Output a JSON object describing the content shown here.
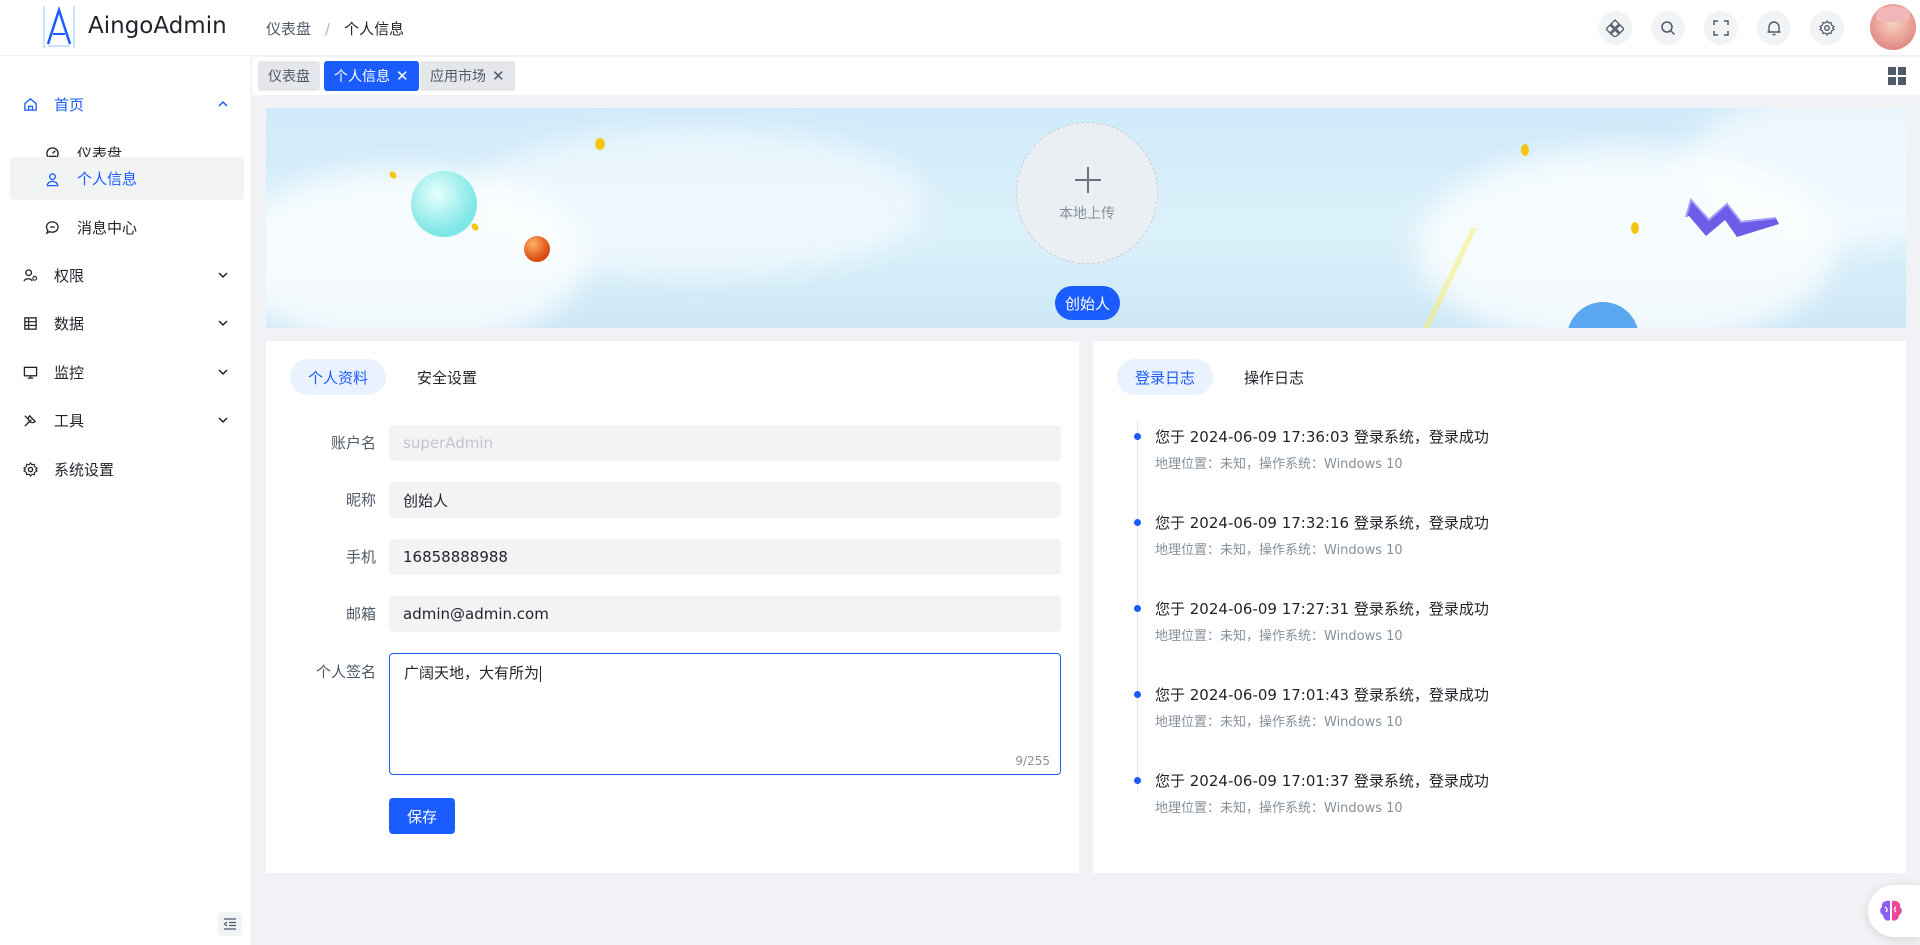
{
  "app": {
    "name": "AingoAdmin"
  },
  "breadcrumb": [
    "仪表盘",
    "个人信息"
  ],
  "header": {
    "icons": [
      "app-grid-icon",
      "search-icon",
      "fullscreen-icon",
      "bell-icon",
      "gear-icon"
    ]
  },
  "sidebar": {
    "items": [
      {
        "label": "首页",
        "icon": "home-icon",
        "expanded": true
      },
      {
        "label": "仪表盘",
        "icon": "dashboard-icon",
        "sub": true
      },
      {
        "label": "个人信息",
        "icon": "user-icon",
        "sub": true,
        "active": true
      },
      {
        "label": "消息中心",
        "icon": "message-icon",
        "sub": true
      },
      {
        "label": "权限",
        "icon": "permission-icon"
      },
      {
        "label": "数据",
        "icon": "data-icon"
      },
      {
        "label": "监控",
        "icon": "monitor-icon"
      },
      {
        "label": "工具",
        "icon": "tool-icon"
      },
      {
        "label": "系统设置",
        "icon": "gear-icon"
      }
    ]
  },
  "tabs": [
    {
      "label": "仪表盘",
      "active": false,
      "closable": false
    },
    {
      "label": "个人信息",
      "active": true,
      "closable": true
    },
    {
      "label": "应用市场",
      "active": false,
      "closable": true
    }
  ],
  "banner": {
    "upload_label": "本地上传",
    "role": "创始人"
  },
  "profile": {
    "tabs": [
      "个人资料",
      "安全设置"
    ],
    "fields": {
      "account": {
        "label": "账户名",
        "value": "superAdmin"
      },
      "nickname": {
        "label": "昵称",
        "value": "创始人"
      },
      "phone": {
        "label": "手机",
        "value": "16858888988"
      },
      "email": {
        "label": "邮箱",
        "value": "admin@admin.com"
      },
      "signature": {
        "label": "个人签名",
        "value": "广阔天地，大有所为",
        "count": "9/255"
      }
    },
    "save_label": "保存"
  },
  "logs": {
    "tabs": [
      "登录日志",
      "操作日志"
    ],
    "entries": [
      {
        "title": "您于 2024-06-09 17:36:03 登录系统，登录成功",
        "desc": "地理位置：未知，操作系统：Windows 10"
      },
      {
        "title": "您于 2024-06-09 17:32:16 登录系统，登录成功",
        "desc": "地理位置：未知，操作系统：Windows 10"
      },
      {
        "title": "您于 2024-06-09 17:27:31 登录系统，登录成功",
        "desc": "地理位置：未知，操作系统：Windows 10"
      },
      {
        "title": "您于 2024-06-09 17:01:43 登录系统，登录成功",
        "desc": "地理位置：未知，操作系统：Windows 10"
      },
      {
        "title": "您于 2024-06-09 17:01:37 登录系统，登录成功",
        "desc": "地理位置：未知，操作系统：Windows 10"
      }
    ]
  },
  "colors": {
    "primary": "#1a5cff",
    "background": "#f0f2f5"
  }
}
